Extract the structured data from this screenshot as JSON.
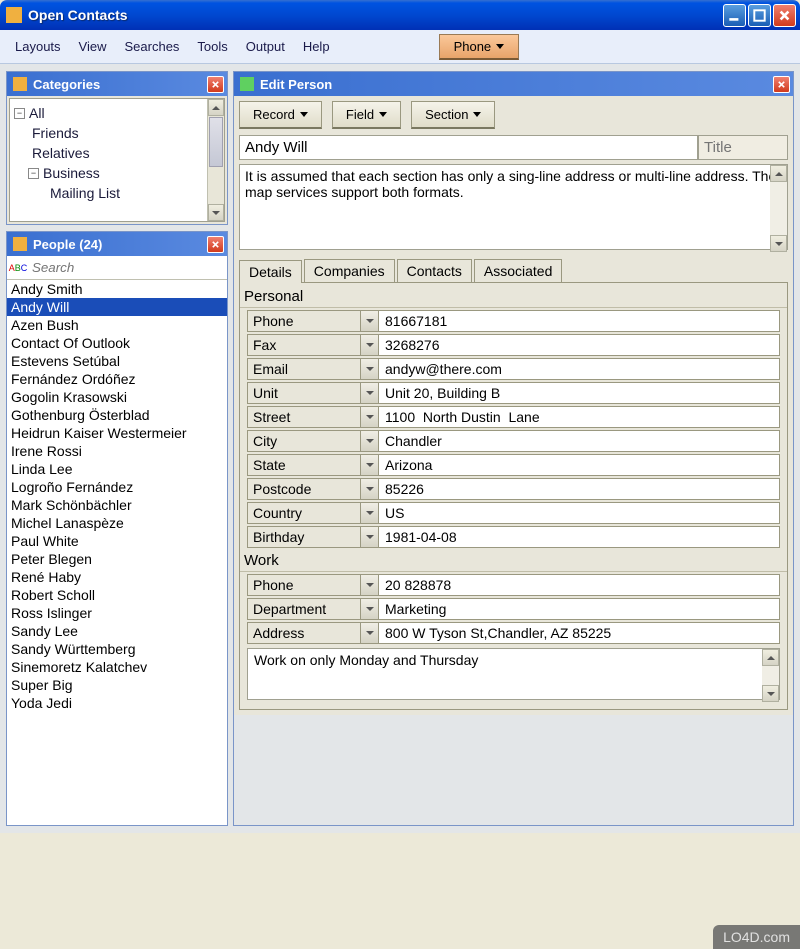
{
  "app": {
    "title": "Open Contacts"
  },
  "menu": {
    "items": [
      "Layouts",
      "View",
      "Searches",
      "Tools",
      "Output",
      "Help"
    ],
    "phone_btn": "Phone"
  },
  "categories": {
    "title": "Categories",
    "tree": {
      "root": "All",
      "items": [
        "Friends",
        "Relatives"
      ],
      "business": "Business",
      "business_items": [
        "Mailing List"
      ]
    }
  },
  "people": {
    "title": "People  (24)",
    "search_placeholder": "Search",
    "items": [
      "Andy Smith",
      "Andy Will",
      "Azen Bush",
      "Contact Of Outlook",
      "Estevens Setúbal",
      "Fernández Ordóñez",
      "Gogolin Krasowski",
      "Gothenburg Österblad",
      "Heidrun Kaiser Westermeier",
      "Irene Rossi",
      "Linda Lee",
      "Logroño Fernández",
      "Mark Schönbächler",
      "Michel Lanaspèze",
      "Paul White",
      "Peter Blegen",
      "René Haby",
      "Robert Scholl",
      "Ross  Islinger",
      "Sandy Lee",
      "Sandy Württemberg",
      "Sinemoretz Kalatchev",
      "Super Big",
      "Yoda Jedi"
    ],
    "selected_index": 1
  },
  "edit": {
    "title": "Edit Person",
    "toolbar": {
      "record": "Record",
      "field": "Field",
      "section": "Section"
    },
    "name": "Andy Will",
    "title_placeholder": "Title",
    "notes": "It is assumed that each section has only a sing-line address or multi-line address. The map services support both formats.",
    "tabs": [
      "Details",
      "Companies",
      "Contacts",
      "Associated"
    ],
    "sections": {
      "personal": {
        "label": "Personal",
        "fields": [
          {
            "name": "Phone",
            "value": "81667181"
          },
          {
            "name": "Fax",
            "value": "3268276"
          },
          {
            "name": "Email",
            "value": "andyw@there.com"
          },
          {
            "name": "Unit",
            "value": "Unit 20, Building B"
          },
          {
            "name": "Street",
            "value": "1100  North Dustin  Lane"
          },
          {
            "name": "City",
            "value": "Chandler"
          },
          {
            "name": "State",
            "value": "Arizona"
          },
          {
            "name": "Postcode",
            "value": "85226"
          },
          {
            "name": "Country",
            "value": "US"
          },
          {
            "name": "Birthday",
            "value": "1981-04-08"
          }
        ]
      },
      "work": {
        "label": "Work",
        "fields": [
          {
            "name": "Phone",
            "value": "20 828878"
          },
          {
            "name": "Department",
            "value": "Marketing"
          },
          {
            "name": "Address",
            "value": "800 W Tyson St,Chandler, AZ 85225"
          }
        ],
        "notes": "Work on only Monday and Thursday"
      }
    }
  },
  "watermark": "LO4D.com"
}
